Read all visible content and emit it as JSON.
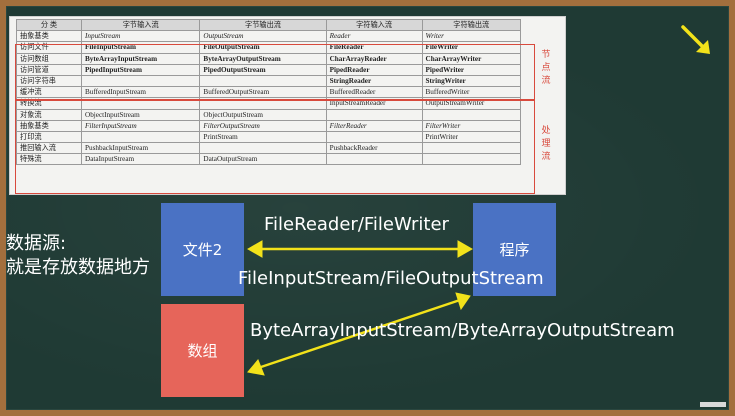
{
  "table": {
    "headers": [
      "分 类",
      "字节输入流",
      "字节输出流",
      "字符输入流",
      "字符输出流"
    ],
    "rows": [
      {
        "cat": "抽象基类",
        "c1": "InputStream",
        "c2": "OutputStream",
        "c3": "Reader",
        "c4": "Writer",
        "style": "i"
      },
      {
        "cat": "访问文件",
        "c1": "FileInputStream",
        "c2": "FileOutputStream",
        "c3": "FileReader",
        "c4": "FileWriter",
        "style": "b"
      },
      {
        "cat": "访问数组",
        "c1": "ByteArrayInputStream",
        "c2": "ByteArrayOutputStream",
        "c3": "CharArrayReader",
        "c4": "CharArrayWriter",
        "style": "b"
      },
      {
        "cat": "访问管道",
        "c1": "PipedInputStream",
        "c2": "PipedOutputStream",
        "c3": "PipedReader",
        "c4": "PipedWriter",
        "style": "b"
      },
      {
        "cat": "访问字符串",
        "c1": "",
        "c2": "",
        "c3": "StringReader",
        "c4": "StringWriter",
        "style": "b"
      },
      {
        "cat": "缓冲流",
        "c1": "BufferedInputStream",
        "c2": "BufferedOutputStream",
        "c3": "BufferedReader",
        "c4": "BufferedWriter",
        "style": ""
      },
      {
        "cat": "转换流",
        "c1": "",
        "c2": "",
        "c3": "InputStreamReader",
        "c4": "OutputStreamWriter",
        "style": ""
      },
      {
        "cat": "对象流",
        "c1": "ObjectInputStream",
        "c2": "ObjectOutputStream",
        "c3": "",
        "c4": "",
        "style": ""
      },
      {
        "cat": "抽象基类",
        "c1": "FilterInputStream",
        "c2": "FilterOutputStream",
        "c3": "FilterReader",
        "c4": "FilterWriter",
        "style": "i"
      },
      {
        "cat": "打印流",
        "c1": "",
        "c2": "PrintStream",
        "c3": "",
        "c4": "PrintWriter",
        "style": ""
      },
      {
        "cat": "推回输入流",
        "c1": "PushbackInputStream",
        "c2": "",
        "c3": "PushbackReader",
        "c4": "",
        "style": ""
      },
      {
        "cat": "特殊流",
        "c1": "DataInputStream",
        "c2": "DataOutputStream",
        "c3": "",
        "c4": "",
        "style": ""
      }
    ],
    "node_label": "节点流",
    "process_label": "处理流"
  },
  "diagram": {
    "source_title_line1": "数据源:",
    "source_title_line2": "就是存放数据地方",
    "file_box": "文件2",
    "program_box": "程序",
    "array_box": "数组",
    "label_reader_writer": "FileReader/FileWriter",
    "label_file_stream": "FileInputStream/FileOutputStream",
    "label_bytearray_stream": "ByteArrayInputStream/ByteArrayOutputStream"
  },
  "colors": {
    "board": "#1f3a34",
    "frame": "#a36f3d",
    "blue_box": "#4a72c4",
    "red_box": "#e6655a",
    "arrow_yellow": "#f2e21a",
    "highlight_red": "#d84a3d"
  }
}
